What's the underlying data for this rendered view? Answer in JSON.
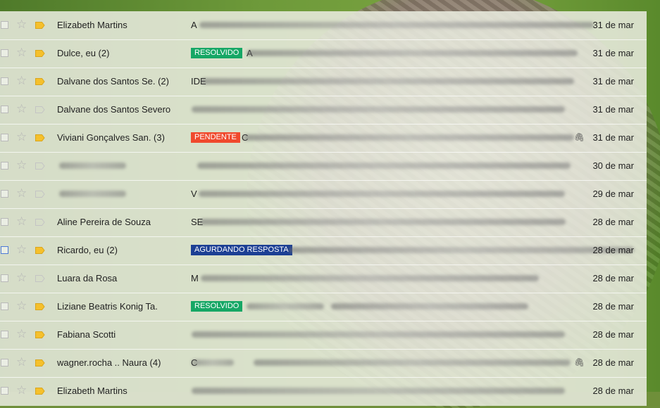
{
  "colors": {
    "label_resolvido": "#16a765",
    "label_pendente": "#f0492d",
    "label_aguardando": "#1c3f94",
    "important_marker": "#f5c02c"
  },
  "icons": {
    "star": "star-icon",
    "important": "important-marker-icon",
    "attachment": "paperclip-icon"
  },
  "rows": [
    {
      "sender": "Elizabeth Martins",
      "label": "",
      "subject": "A",
      "date": "31 de mar",
      "important": true,
      "attachment": false
    },
    {
      "sender": "Dulce, eu (2)",
      "label": "RESOLVIDO",
      "subject": "A",
      "date": "31 de mar",
      "important": true,
      "attachment": false
    },
    {
      "sender": "Dalvane dos Santos Se. (2)",
      "label": "",
      "subject": "IDE",
      "date": "31 de mar",
      "important": true,
      "attachment": false
    },
    {
      "sender": "Dalvane dos Santos Severo",
      "label": "",
      "subject": "",
      "date": "31 de mar",
      "important": false,
      "attachment": false
    },
    {
      "sender": "Viviani Gonçalves San. (3)",
      "label": "PENDENTE",
      "subject": "C",
      "date": "31 de mar",
      "important": true,
      "attachment": true
    },
    {
      "sender": "",
      "label": "",
      "subject": "",
      "date": "30 de mar",
      "important": false,
      "attachment": false
    },
    {
      "sender": "",
      "label": "",
      "subject": "V",
      "date": "29 de mar",
      "important": false,
      "attachment": false
    },
    {
      "sender": "Aline Pereira de Souza",
      "label": "",
      "subject": "SE",
      "date": "28 de mar",
      "important": false,
      "attachment": false
    },
    {
      "sender": "Ricardo, eu (2)",
      "label": "AGURDANDO RESPOSTA",
      "subject": "",
      "date": "28 de mar",
      "important": true,
      "attachment": false
    },
    {
      "sender": "Luara da Rosa",
      "label": "",
      "subject": "M",
      "date": "28 de mar",
      "important": false,
      "attachment": false
    },
    {
      "sender": "Liziane Beatris Konig Ta.",
      "label": "RESOLVIDO",
      "subject": "",
      "date": "28 de mar",
      "important": true,
      "attachment": false
    },
    {
      "sender": "Fabiana Scotti",
      "label": "",
      "subject": "",
      "date": "28 de mar",
      "important": true,
      "attachment": false
    },
    {
      "sender": "wagner.rocha .. Naura (4)",
      "label": "",
      "subject": "C",
      "date": "28 de mar",
      "important": true,
      "attachment": true
    },
    {
      "sender": "Elizabeth Martins",
      "label": "",
      "subject": "",
      "date": "28 de mar",
      "important": true,
      "attachment": false
    }
  ]
}
